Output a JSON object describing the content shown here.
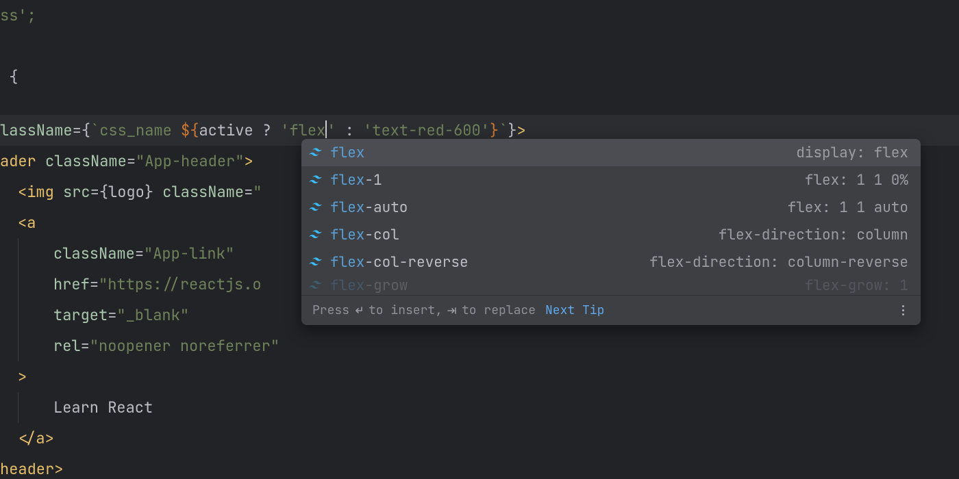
{
  "code": {
    "frag_css": "ss';",
    "l1_brace": " {",
    "l_hl": {
      "pre": "lassName",
      "eq": "=",
      "ob": "{",
      "bt1": "`",
      "s1": "css_name ",
      "dol": "$",
      "ib": "{",
      "var": "active ",
      "q": "? ",
      "sq1": "'",
      "val1": "flex",
      "sq1c": "'",
      "colon": " : ",
      "sq2": "'",
      "val2": "text-red-600",
      "sq2c": "'",
      "cb": "}",
      "bt2": "`",
      "cob": "}",
      "gt": ">"
    },
    "l_header": {
      "pre": "ader ",
      "attr": "className",
      "eq": "=",
      "q": "\"",
      "val": "App-header",
      "qc": "\"",
      "gt": ">"
    },
    "l_img": {
      "tag_open": "<img ",
      "a1": "src",
      "eq1": "=",
      "ob": "{",
      "var": "logo",
      "cb": "} ",
      "a2": "className",
      "eq2": "=",
      "q": "\""
    },
    "l_a_open": "<a",
    "l_class": {
      "attr": "className",
      "eq": "=",
      "q": "\"",
      "val": "App-link",
      "qc": "\""
    },
    "l_href": {
      "attr": "href",
      "eq": "=",
      "q": "\"",
      "val": "https://reactjs.o",
      "tail": ""
    },
    "l_target": {
      "attr": "target",
      "eq": "=",
      "q": "\"",
      "val": "_blank",
      "qc": "\""
    },
    "l_rel": {
      "attr": "rel",
      "eq": "=",
      "q": "\"",
      "val": "noopener noreferrer",
      "qc": "\""
    },
    "l_a_gt": ">",
    "l_text": "Learn React",
    "l_a_close_open": "</",
    "l_a_close_name": "a",
    "l_a_close_gt": ">",
    "l_header_close_pre": "header",
    "l_header_close_gt": ">"
  },
  "popup": {
    "items": [
      {
        "match": "flex",
        "rest": "",
        "hint": "display: flex"
      },
      {
        "match": "flex",
        "rest": "-1",
        "hint": "flex: 1 1 0%"
      },
      {
        "match": "flex",
        "rest": "-auto",
        "hint": "flex: 1 1 auto"
      },
      {
        "match": "flex",
        "rest": "-col",
        "hint": "flex-direction: column"
      },
      {
        "match": "flex",
        "rest": "-col-reverse",
        "hint": "flex-direction: column-reverse"
      },
      {
        "match": "flex",
        "rest": "-grow",
        "hint": "flex-grow: 1"
      }
    ],
    "status": {
      "press": "Press ",
      "insert": " to insert, ",
      "replace": " to replace",
      "next_tip": "Next Tip"
    }
  }
}
